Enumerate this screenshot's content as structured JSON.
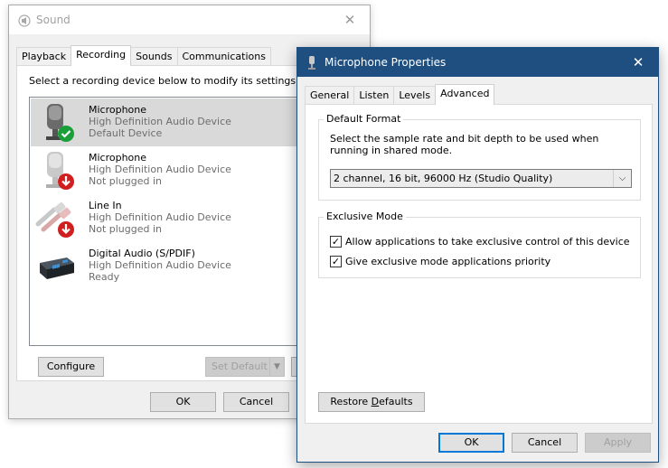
{
  "sound": {
    "title": "Sound",
    "tabs": [
      "Playback",
      "Recording",
      "Sounds",
      "Communications"
    ],
    "instruction": "Select a recording device below to modify its settings:",
    "devices": [
      {
        "name": "Microphone",
        "sub": "High Definition Audio Device",
        "state": "Default Device",
        "icon": "microphone-default-icon"
      },
      {
        "name": "Microphone",
        "sub": "High Definition Audio Device",
        "state": "Not plugged in",
        "icon": "microphone-unplugged-icon"
      },
      {
        "name": "Line In",
        "sub": "High Definition Audio Device",
        "state": "Not plugged in",
        "icon": "line-in-unplugged-icon"
      },
      {
        "name": "Digital Audio (S/PDIF)",
        "sub": "High Definition Audio Device",
        "state": "Ready",
        "icon": "digital-audio-icon"
      }
    ],
    "configure_label": "Configure",
    "set_default_label": "Set Default",
    "properties_label_partial": "P",
    "ok_label": "OK",
    "cancel_label": "Cancel"
  },
  "props": {
    "title": "Microphone Properties",
    "tabs": [
      "General",
      "Listen",
      "Levels",
      "Advanced"
    ],
    "default_format": {
      "label": "Default Format",
      "description": "Select the sample rate and bit depth to be used when running in shared mode.",
      "selected": "2 channel, 16 bit, 96000 Hz (Studio Quality)"
    },
    "exclusive": {
      "label": "Exclusive Mode",
      "options": [
        {
          "label": "Allow applications to take exclusive control of this device",
          "checked": true
        },
        {
          "label": "Give exclusive mode applications priority",
          "checked": true
        }
      ]
    },
    "restore_pre": "Restore ",
    "restore_u": "D",
    "restore_post": "efaults",
    "ok_label": "OK",
    "cancel_label": "Cancel",
    "apply_label": "Apply"
  },
  "colors": {
    "accent": "#0078d7",
    "titlebar_active": "#1e4f80",
    "check_green": "#1a9e3a",
    "unplugged_red": "#d01f1f"
  }
}
